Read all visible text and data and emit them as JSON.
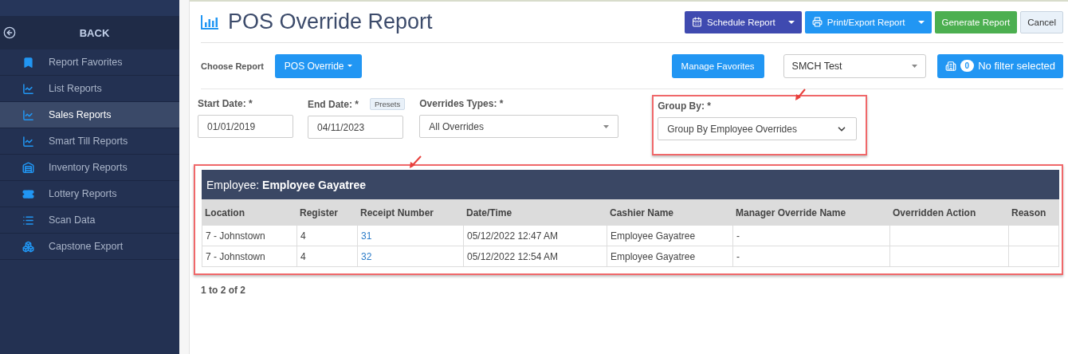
{
  "sidebar": {
    "back_label": "BACK",
    "items": [
      {
        "label": "Report Favorites",
        "kind": "bookmark",
        "selected": false
      },
      {
        "label": "List Reports",
        "kind": "chart",
        "selected": false
      },
      {
        "label": "Sales Reports",
        "kind": "chart",
        "selected": true
      },
      {
        "label": "Smart Till Reports",
        "kind": "chart",
        "selected": false
      },
      {
        "label": "Inventory Reports",
        "kind": "inventory",
        "selected": false
      },
      {
        "label": "Lottery Reports",
        "kind": "ticket",
        "selected": false
      },
      {
        "label": "Scan Data",
        "kind": "list",
        "selected": false
      },
      {
        "label": "Capstone Export",
        "kind": "boxes",
        "selected": false
      }
    ]
  },
  "header": {
    "title": "POS Override Report",
    "buttons": [
      {
        "label": "Schedule Report",
        "kind": "schedule",
        "has_menu": true
      },
      {
        "label": "Print/Export Report",
        "kind": "print",
        "has_menu": true
      },
      {
        "label": "Generate Report",
        "kind": "generate",
        "has_menu": false
      },
      {
        "label": "Cancel",
        "kind": "cancel",
        "has_menu": false
      }
    ]
  },
  "toolbar": {
    "choose_report_label": "Choose Report",
    "report_dropdown": "POS Override",
    "manage_favorites": "Manage Favorites",
    "store_select": "SMCH Test",
    "filter_count": "0",
    "filter_label": "No filter selected"
  },
  "filters": {
    "start_date": {
      "label": "Start Date: *",
      "value": "01/01/2019"
    },
    "end_date": {
      "label": "End Date: *",
      "value": "04/11/2023",
      "presets": "Presets"
    },
    "overrides_type": {
      "label": "Overrides Types: *",
      "value": "All Overrides"
    },
    "group_by": {
      "label": "Group By: *",
      "value": "Group By Employee Overrides"
    }
  },
  "table": {
    "group_label": "Employee:",
    "group_value": "Employee Gayatree",
    "columns": [
      "Location",
      "Register",
      "Receipt Number",
      "Date/Time",
      "Cashier Name",
      "Manager Override Name",
      "Overridden Action",
      "Reason"
    ],
    "rows": [
      {
        "location": "7 - Johnstown",
        "register": "4",
        "receipt_number": "31",
        "date_time": "05/12/2022 12:47 AM",
        "cashier_name": "Employee Gayatree",
        "manager_override_name": "-"
      },
      {
        "location": "7 - Johnstown",
        "register": "4",
        "receipt_number": "32",
        "date_time": "05/12/2022 12:54 AM",
        "cashier_name": "Employee Gayatree",
        "manager_override_name": "-"
      }
    ]
  },
  "pagination": "1 to 2 of 2"
}
